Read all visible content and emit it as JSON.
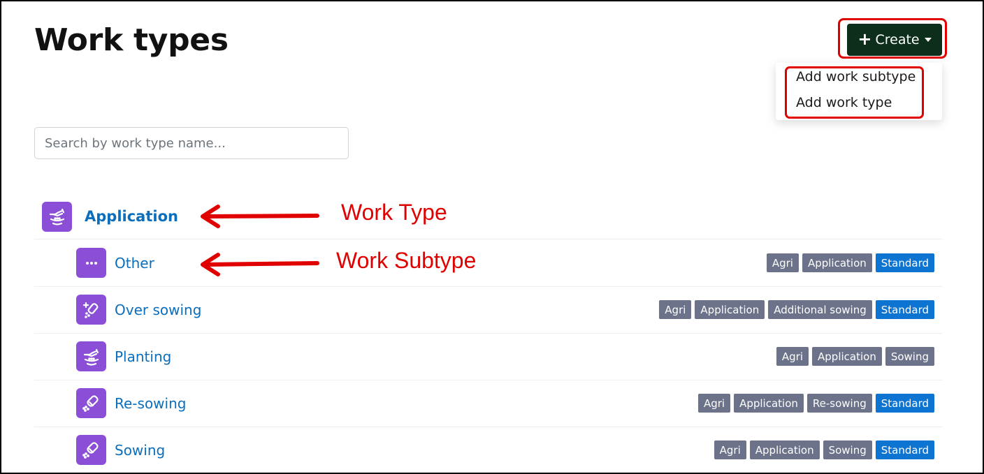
{
  "page": {
    "title": "Work types"
  },
  "toolbar": {
    "create_label": "Create",
    "create_icon": "plus-icon",
    "dropdown_icon": "caret-down-icon",
    "accent_color": "#0d2e1a"
  },
  "create_menu": {
    "items": [
      "Add work subtype",
      "Add work type"
    ]
  },
  "search": {
    "placeholder": "Search by work type name...",
    "value": ""
  },
  "work_type": {
    "name": "Application",
    "icon": "planting-hand-icon",
    "icon_color": "#8a4fd6"
  },
  "subtypes": [
    {
      "name": "Other",
      "icon": "ellipsis-icon",
      "tags": [
        {
          "label": "Agri",
          "style": "gray"
        },
        {
          "label": "Application",
          "style": "gray"
        },
        {
          "label": "Standard",
          "style": "blue"
        }
      ]
    },
    {
      "name": "Over sowing",
      "icon": "over-sowing-icon",
      "tags": [
        {
          "label": "Agri",
          "style": "gray"
        },
        {
          "label": "Application",
          "style": "gray"
        },
        {
          "label": "Additional sowing",
          "style": "gray"
        },
        {
          "label": "Standard",
          "style": "blue"
        }
      ]
    },
    {
      "name": "Planting",
      "icon": "planting-hand-icon",
      "tags": [
        {
          "label": "Agri",
          "style": "gray"
        },
        {
          "label": "Application",
          "style": "gray"
        },
        {
          "label": "Sowing",
          "style": "gray"
        }
      ]
    },
    {
      "name": "Re-sowing",
      "icon": "seed-shaker-icon",
      "tags": [
        {
          "label": "Agri",
          "style": "gray"
        },
        {
          "label": "Application",
          "style": "gray"
        },
        {
          "label": "Re-sowing",
          "style": "gray"
        },
        {
          "label": "Standard",
          "style": "blue"
        }
      ]
    },
    {
      "name": "Sowing",
      "icon": "seed-shaker-icon",
      "tags": [
        {
          "label": "Agri",
          "style": "gray"
        },
        {
          "label": "Application",
          "style": "gray"
        },
        {
          "label": "Sowing",
          "style": "gray"
        },
        {
          "label": "Standard",
          "style": "blue"
        }
      ]
    }
  ],
  "tag_colors": {
    "gray": "#6b7289",
    "blue": "#0d74d1"
  },
  "annotations": {
    "work_type_label": "Work Type",
    "work_subtype_label": "Work Subtype",
    "color": "#e00000"
  }
}
